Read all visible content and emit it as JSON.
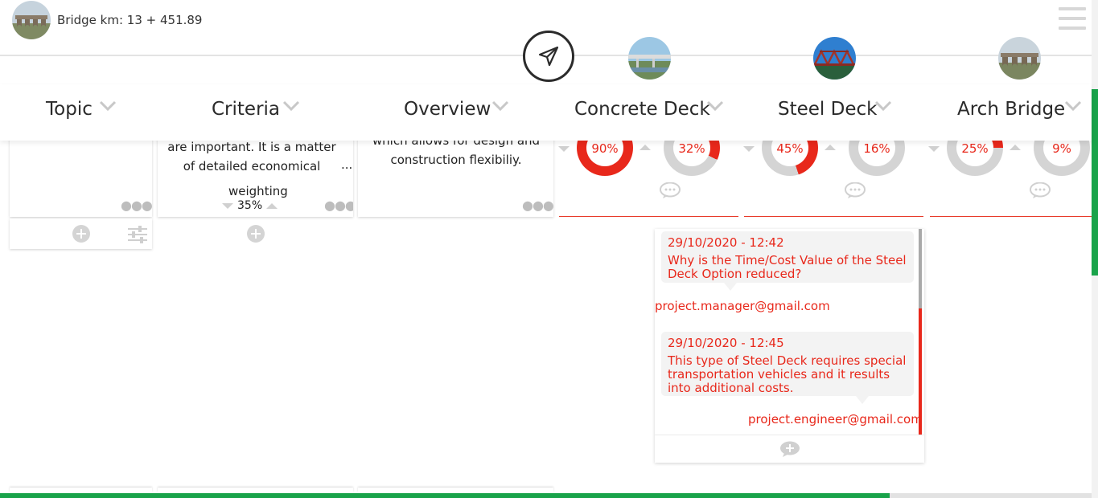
{
  "header": {
    "bridge_label": "Bridge km: 13 + 451.89",
    "menu_icon": "hamburger-menu-icon",
    "send_icon": "send-paper-plane-icon"
  },
  "columns": [
    {
      "label": "Topic"
    },
    {
      "label": "Criteria"
    },
    {
      "label": "Overview"
    },
    {
      "label": "Concrete Deck"
    },
    {
      "label": "Steel Deck"
    },
    {
      "label": "Arch Bridge"
    }
  ],
  "criteria": {
    "text_line1": "are important. It is a matter",
    "text_line2": "of detailed economical",
    "more": "...",
    "weighting_label": "weighting",
    "weighting_value": "35%"
  },
  "overview": {
    "text_line1": "which allows for design and",
    "text_line2": "construction flexibiliy."
  },
  "scores": {
    "concrete": [
      {
        "label": "90%",
        "value": 90
      },
      {
        "label": "32%",
        "value": 32
      }
    ],
    "steel": [
      {
        "label": "45%",
        "value": 45
      },
      {
        "label": "16%",
        "value": 16
      }
    ],
    "arch": [
      {
        "label": "25%",
        "value": 25
      },
      {
        "label": "9%",
        "value": 9
      }
    ]
  },
  "comments": [
    {
      "date": "29/10/2020 - 12:42",
      "text": "Why is the Time/Cost Value of the Steel Deck Option reduced?",
      "author": "project.manager@gmail.com"
    },
    {
      "date": "29/10/2020 - 12:45",
      "text": "This type of Steel Deck requires special transportation vehicles and it results into additional costs.",
      "author": "project.engineer@gmail.com"
    }
  ],
  "progress": {
    "value": 0.815
  },
  "colors": {
    "accent_red": "#e8281b",
    "accent_green": "#19a34a",
    "donut_track": "#d4d4d4"
  }
}
